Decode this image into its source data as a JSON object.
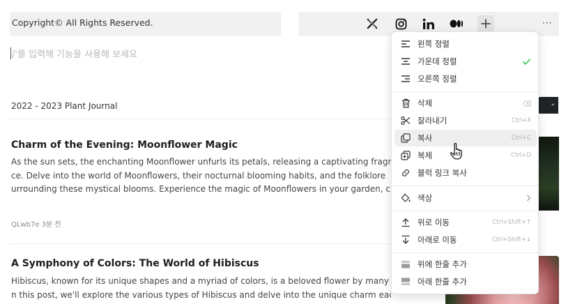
{
  "footer": {
    "copyright": "Copyright© All Rights Reserved.",
    "socials": [
      "x-icon",
      "instagram-icon",
      "linkedin-icon",
      "medium-icon"
    ],
    "more": "···"
  },
  "editor": {
    "placeholder": "/'를 입력해 기능을 사용해 보세요"
  },
  "journal_title": "2022 - 2023 Plant Journal",
  "posts": [
    {
      "title": "Charm of the Evening: Moonflower Magic",
      "lines": [
        "As the sun sets, the enchanting Moonflower unfurls its petals, releasing a captivating fragr",
        "ce. Delve into the world of Moonflowers, their nocturnal blooming habits, and the folklore",
        "urrounding these mystical blooms. Experience the magic of Moonflowers in your garden, c"
      ],
      "author": "QLwb7e",
      "time": "3분 전"
    },
    {
      "title": "A Symphony of Colors: The World of Hibiscus",
      "lines": [
        "Hibiscus, known for its unique shapes and a myriad of colors, is a beloved flower by many",
        "n this post, we'll explore the various types of Hibiscus and delve into the unique charm each"
      ]
    }
  ],
  "context_menu": {
    "align": [
      {
        "label": "왼쪽 정렬",
        "icon": "align-left-icon"
      },
      {
        "label": "가운데 정렬",
        "icon": "align-center-icon",
        "checked": true
      },
      {
        "label": "오른쪽 정렬",
        "icon": "align-right-icon"
      }
    ],
    "edit": [
      {
        "label": "삭제",
        "icon": "trash-icon",
        "shortcut_icon": "backspace-icon"
      },
      {
        "label": "잘라내기",
        "icon": "scissors-icon",
        "shortcut": "Ctrl+X"
      },
      {
        "label": "복사",
        "icon": "copy-icon",
        "shortcut": "Ctrl+C",
        "hovered": true
      },
      {
        "label": "복제",
        "icon": "duplicate-icon",
        "shortcut": "Ctrl+D"
      },
      {
        "label": "블럭 링크 복사",
        "icon": "link-icon"
      }
    ],
    "color": {
      "label": "색상",
      "icon": "paint-bucket-icon",
      "submenu": true
    },
    "move": [
      {
        "label": "위로 이동",
        "icon": "arrow-up-icon",
        "shortcut": "Ctrl+Shift+↑"
      },
      {
        "label": "아래로 이동",
        "icon": "arrow-down-icon",
        "shortcut": "Ctrl+Shift+↓"
      }
    ],
    "insert": [
      {
        "label": "위에 한줄 추가",
        "icon": "insert-above-icon"
      },
      {
        "label": "아래 한줄 추가",
        "icon": "insert-below-icon"
      }
    ]
  },
  "colors": {
    "check": "#34c759",
    "menu_hover": "#efefef"
  }
}
